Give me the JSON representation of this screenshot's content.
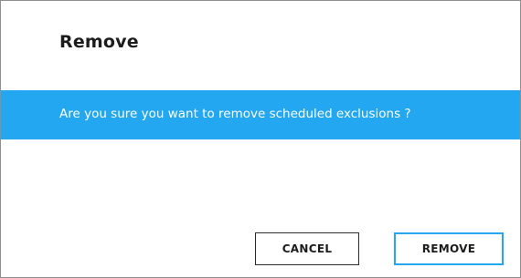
{
  "dialog": {
    "title": "Remove",
    "message": "Are you sure you want to remove scheduled exclusions ?",
    "cancel_label": "CANCEL",
    "confirm_label": "REMOVE"
  },
  "colors": {
    "accent": "#22a7f0",
    "banner_text": "#ffffff",
    "border": "#8f8f8f"
  }
}
